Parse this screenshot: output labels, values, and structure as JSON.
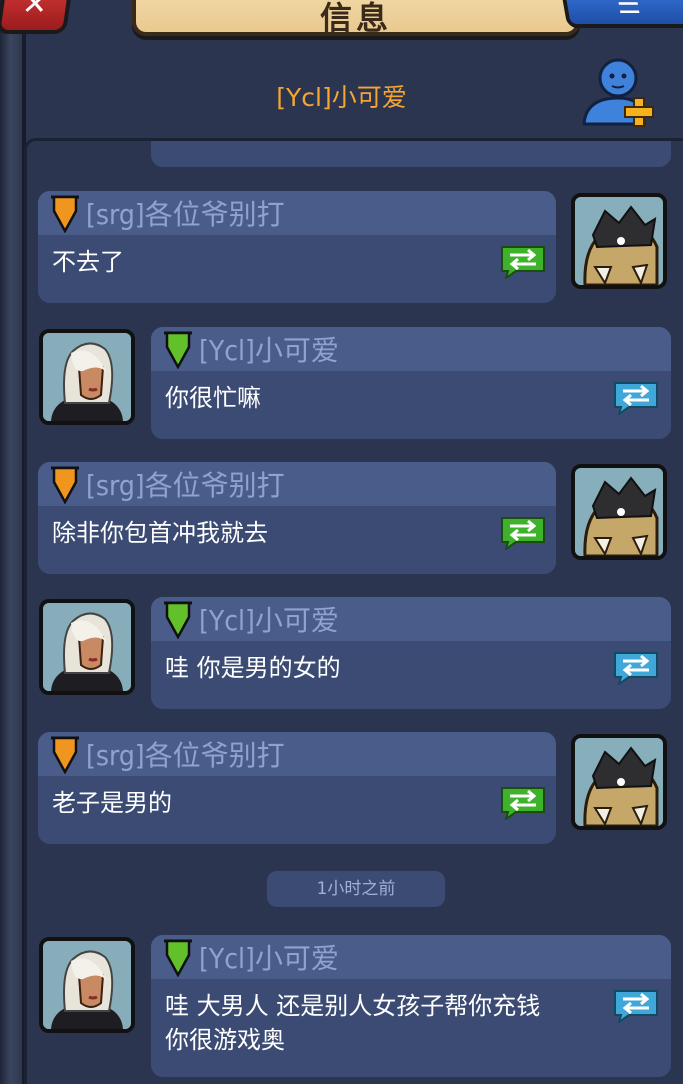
{
  "header": {
    "title": "信息",
    "chat_partner": "[Ycl]小可爱"
  },
  "messages": [
    {
      "side": "left",
      "sender": "[srg]各位爷别打",
      "text": "不去了"
    },
    {
      "side": "right",
      "sender": "[Ycl]小可爱",
      "text": "你很忙嘛"
    },
    {
      "side": "left",
      "sender": "[srg]各位爷别打",
      "text": "除非你包首冲我就去"
    },
    {
      "side": "right",
      "sender": "[Ycl]小可爱",
      "text": "哇 你是男的女的"
    },
    {
      "side": "left",
      "sender": "[srg]各位爷别打",
      "text": "老子是男的"
    },
    {
      "side": "right",
      "sender": "[Ycl]小可爱",
      "text_line1": "哇  大男人 还是别人女孩子帮你充钱",
      "text_line2": "你很游戏奥"
    }
  ],
  "timestamp": "1小时之前",
  "colors": {
    "background": "#2b3550",
    "bubble": "#3b4b74",
    "bubble_header": "#4a5c8a",
    "sender_text": "#8fa3d1",
    "partner_name": "#f4a631",
    "green_share": "#3fb22b",
    "blue_share": "#3fa8d8",
    "orange_flag": "#f0961e",
    "green_flag": "#62c02a"
  },
  "icons": {
    "close": "close-icon",
    "add_friend": "add-friend-icon",
    "share_green": "share-arrows-icon",
    "share_blue": "share-arrows-icon",
    "rank_flag": "rank-flag-icon"
  }
}
